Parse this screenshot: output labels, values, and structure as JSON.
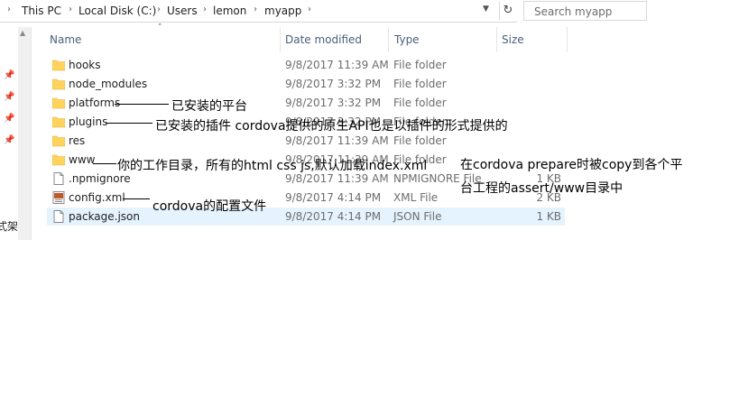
{
  "address_bar": {
    "crumbs": [
      "This PC",
      "Local Disk (C:)",
      "Users",
      "lemon",
      "myapp"
    ],
    "search_placeholder": "Search myapp"
  },
  "columns": {
    "name": "Name",
    "date": "Date modified",
    "type": "Type",
    "size": "Size"
  },
  "files": [
    {
      "name": "hooks",
      "date": "9/8/2017 11:39 AM",
      "type": "File folder",
      "size": "",
      "icon": "folder-icon"
    },
    {
      "name": "node_modules",
      "date": "9/8/2017 3:32 PM",
      "type": "File folder",
      "size": "",
      "icon": "folder-icon"
    },
    {
      "name": "platforms",
      "date": "9/8/2017 3:32 PM",
      "type": "File folder",
      "size": "",
      "icon": "folder-icon"
    },
    {
      "name": "plugins",
      "date": "9/8/2017 3:32 PM",
      "type": "File folder",
      "size": "",
      "icon": "folder-icon"
    },
    {
      "name": "res",
      "date": "9/8/2017 11:39 AM",
      "type": "File folder",
      "size": "",
      "icon": "folder-icon"
    },
    {
      "name": "www",
      "date": "9/8/2017 11:39 AM",
      "type": "File folder",
      "size": "",
      "icon": "folder-icon"
    },
    {
      "name": ".npmignore",
      "date": "9/8/2017 11:39 AM",
      "type": "NPMIGNORE File",
      "size": "1 KB",
      "icon": "file-icon"
    },
    {
      "name": "config.xml",
      "date": "9/8/2017 4:14 PM",
      "type": "XML File",
      "size": "2 KB",
      "icon": "xml-file-icon"
    },
    {
      "name": "package.json",
      "date": "9/8/2017 4:14 PM",
      "type": "JSON File",
      "size": "1 KB",
      "icon": "file-icon"
    }
  ],
  "nav_cut_text": "式架",
  "annotations": {
    "platforms": "已安装的平台",
    "plugins": "已安装的插件 cordova提供的原生API也是以插件的形式提供的",
    "www": "你的工作目录，所有的html css js,默认加载index.xml",
    "www_note_line1": "在cordova prepare时被copy到各个平",
    "www_note_line2": "台工程的assert/www目录中",
    "config": "cordova的配置文件"
  },
  "colors": {
    "folder": "#ffd35c",
    "header_text": "#4c607a",
    "selected_row": "#e5f3ff"
  }
}
